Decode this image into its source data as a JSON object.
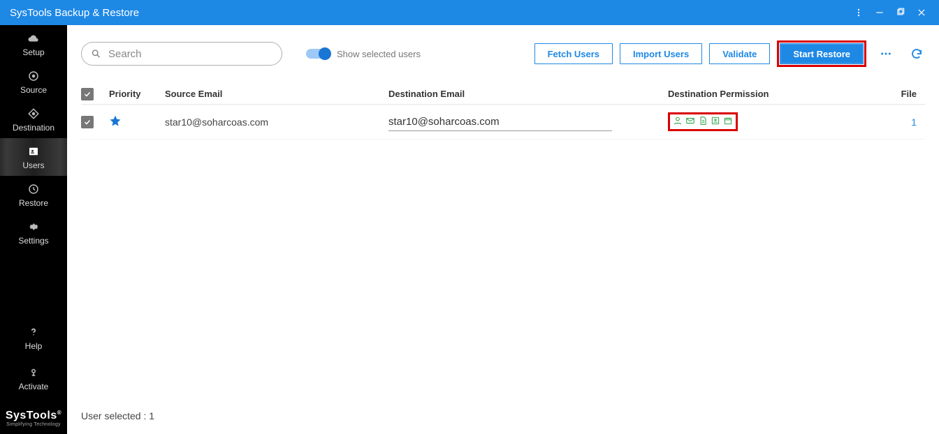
{
  "titlebar": {
    "title": "SysTools Backup & Restore"
  },
  "sidebar": {
    "items": [
      {
        "label": "Setup",
        "icon": "cloud"
      },
      {
        "label": "Source",
        "icon": "target"
      },
      {
        "label": "Destination",
        "icon": "diamond"
      },
      {
        "label": "Users",
        "icon": "card",
        "active": true
      },
      {
        "label": "Restore",
        "icon": "clock"
      },
      {
        "label": "Settings",
        "icon": "gear"
      }
    ],
    "help_label": "Help",
    "activate_label": "Activate",
    "brand_line1": "SysTools",
    "brand_line2": "Simplifying Technology"
  },
  "toolbar": {
    "search_placeholder": "Search",
    "toggle_label": "Show selected users",
    "fetch_label": "Fetch Users",
    "import_label": "Import Users",
    "validate_label": "Validate",
    "start_label": "Start Restore"
  },
  "table": {
    "headers": {
      "priority": "Priority",
      "source": "Source Email",
      "destination": "Destination Email",
      "permission": "Destination Permission",
      "file": "File"
    },
    "rows": [
      {
        "checked": true,
        "starred": true,
        "source": "star10@soharcoas.com",
        "destination": "star10@soharcoas.com",
        "file": "1"
      }
    ]
  },
  "status": {
    "text": "User selected : 1"
  }
}
